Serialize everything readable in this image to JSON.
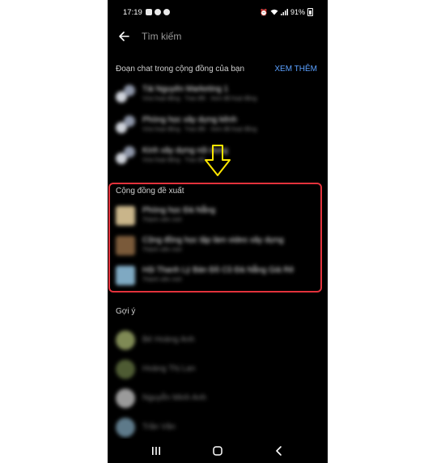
{
  "status_bar": {
    "time": "17:19",
    "battery": "91%"
  },
  "header": {
    "back_icon": "arrow-left-icon",
    "search_placeholder": "Tìm kiếm"
  },
  "community_chats": {
    "title": "Đoạn chat trong cộng đồng của bạn",
    "see_more": "XEM THÊM",
    "items": [
      {
        "title": "Tài Nguyên Marketing 1",
        "subtitle": "Vừa hoạt động · Trao đổi · Xem đã hoạt động"
      },
      {
        "title": "Phòng học xây dựng kênh",
        "subtitle": "Vừa hoạt động · Trao đổi · Xem đã hoạt động"
      },
      {
        "title": "Kinh xây dựng nội dung",
        "subtitle": "Vừa hoạt động · Trao đổi"
      }
    ]
  },
  "suggested_communities": {
    "title": "Cộng đồng đề xuất",
    "items": [
      {
        "title": "Phòng học Đà Nẵng",
        "subtitle": "Thành viên mới"
      },
      {
        "title": "Cộng đồng học tập làm video xây dựng",
        "subtitle": "Thành viên mới"
      },
      {
        "title": "Hội Thanh Lý Bán Đồ Cũ Đà Nẵng Giá Rẻ",
        "subtitle": "Thành viên mới"
      }
    ]
  },
  "suggestions": {
    "title": "Gợi ý",
    "items": [
      {
        "name": "Bé Hoàng Anh"
      },
      {
        "name": "Hoàng Thị Lan"
      },
      {
        "name": "Nguyễn Minh Anh"
      },
      {
        "name": "Trần Văn"
      }
    ]
  },
  "colors": {
    "accent": "#5aa0ff",
    "highlight": "#e3323c",
    "arrow": "#ffe600",
    "background": "#000000"
  },
  "nav_icons": [
    "recents-icon",
    "home-icon",
    "back-nav-icon"
  ]
}
